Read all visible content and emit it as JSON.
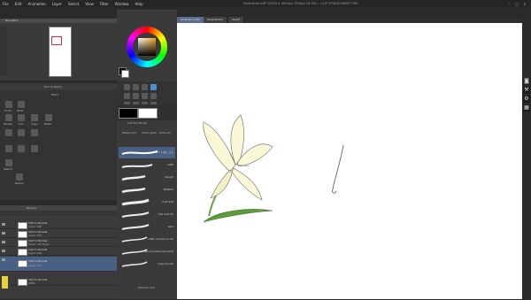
{
  "menu": [
    "File",
    "Edit",
    "Animation",
    "Layer",
    "Select",
    "View",
    "Filter",
    "Window",
    "Help"
  ],
  "app_title": "Illustration1DP (2000 x 3000px 350dpi 16.0%) - CLIP STUDIO PAINT PRO",
  "navigator": {
    "title": "Navigator"
  },
  "subtool": {
    "header": "Tool property",
    "name": "Edit 1",
    "buttons": [
      {
        "label": "Undo"
      },
      {
        "label": "Redo"
      },
      {
        "label": "Delete"
      },
      {
        "label": "Cut"
      },
      {
        "label": "Copy"
      },
      {
        "label": "Paste"
      },
      {
        "label": "Sketch"
      },
      {
        "label": "Return"
      }
    ]
  },
  "layers": {
    "blend_mode": "Normal",
    "rows": [
      {
        "name": "100 % Normal",
        "sub": "Layer 146"
      },
      {
        "name": "100 % Normal",
        "sub": "Layer 145"
      },
      {
        "name": "100 % Normal",
        "sub": "Layer 144 Copy"
      },
      {
        "name": "100 % Normal",
        "sub": "Layer 144"
      },
      {
        "name": "100 % Normal",
        "sub": "Layer 147"
      },
      {
        "name": "100 % Normal",
        "sub": "PKE1"
      }
    ]
  },
  "brush_panel": {
    "header": "Sub Tool Brush",
    "tabs": [
      "Watercolor",
      "Thick paint",
      "Airbrush"
    ],
    "brushes": [
      {
        "name": "ソフト消しゴム"
      },
      {
        "name": "GRD"
      },
      {
        "name": "Rough"
      },
      {
        "name": "Rabbits"
      },
      {
        "name": "Flat Soft"
      },
      {
        "name": "Flat Soft 3x"
      },
      {
        "name": "G24"
      },
      {
        "name": "chalk marker brush"
      },
      {
        "name": "dark pointed cat paint"
      },
      {
        "name": "maya brush"
      }
    ],
    "add_label": "Add sub tool"
  },
  "canvas": {
    "tabs": [
      "Illustration1DP",
      "Illustration2",
      "Illust3"
    ],
    "background": "#ffffff"
  },
  "icons": [
    "camera-icon",
    "wrench-icon",
    "gear-icon",
    "grid-icon"
  ],
  "colors": {
    "main_color": "#000000",
    "sub_color": "#ffffff",
    "petal_fill": "#fbf8d8",
    "leaf_fill": "#5e9b3c"
  }
}
